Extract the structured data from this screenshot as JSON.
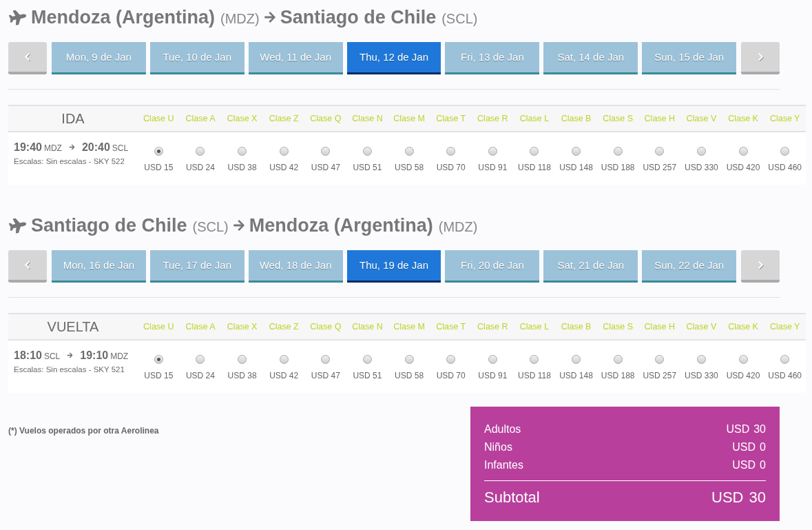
{
  "flights": [
    {
      "origin": {
        "city": "Mendoza (Argentina)",
        "code": "(MDZ)"
      },
      "destination": {
        "city": "Santiago de Chile",
        "code": "(SCL)"
      },
      "dates": [
        {
          "label": "Mon, 9 de Jan",
          "selected": false
        },
        {
          "label": "Tue, 10 de Jan",
          "selected": false
        },
        {
          "label": "Wed, 11 de Jan",
          "selected": false
        },
        {
          "label": "Thu, 12 de Jan",
          "selected": true
        },
        {
          "label": "Fri, 13 de Jan",
          "selected": false
        },
        {
          "label": "Sat, 14 de Jan",
          "selected": false
        },
        {
          "label": "Sun, 15 de Jan",
          "selected": false
        }
      ],
      "table": {
        "direction": "IDA",
        "classes": [
          "Clase U",
          "Clase A",
          "Clase X",
          "Clase Z",
          "Clase Q",
          "Clase N",
          "Clase M",
          "Clase T",
          "Clase R",
          "Clase L",
          "Clase B",
          "Clase S",
          "Clase H",
          "Clase V",
          "Clase K",
          "Clase Y"
        ],
        "flight": {
          "departure_time": "19:40",
          "departure_code": "MDZ",
          "arrival_time": "20:40",
          "arrival_code": "SCL",
          "details": "Escalas: Sin escalas - SKY 522"
        },
        "fares": [
          {
            "price": "USD 15",
            "selected": true
          },
          {
            "price": "USD 24",
            "selected": false
          },
          {
            "price": "USD 38",
            "selected": false
          },
          {
            "price": "USD 42",
            "selected": false
          },
          {
            "price": "USD 47",
            "selected": false
          },
          {
            "price": "USD 51",
            "selected": false
          },
          {
            "price": "USD 58",
            "selected": false
          },
          {
            "price": "USD 70",
            "selected": false
          },
          {
            "price": "USD 91",
            "selected": false
          },
          {
            "price": "USD 118",
            "selected": false
          },
          {
            "price": "USD 148",
            "selected": false
          },
          {
            "price": "USD 188",
            "selected": false
          },
          {
            "price": "USD 257",
            "selected": false
          },
          {
            "price": "USD 330",
            "selected": false
          },
          {
            "price": "USD 420",
            "selected": false
          },
          {
            "price": "USD 460",
            "selected": false
          }
        ]
      }
    },
    {
      "origin": {
        "city": "Santiago de Chile",
        "code": "(SCL)"
      },
      "destination": {
        "city": "Mendoza (Argentina)",
        "code": "(MDZ)"
      },
      "dates": [
        {
          "label": "Mon, 16 de Jan",
          "selected": false
        },
        {
          "label": "Tue, 17 de Jan",
          "selected": false
        },
        {
          "label": "Wed, 18 de Jan",
          "selected": false
        },
        {
          "label": "Thu, 19 de Jan",
          "selected": true
        },
        {
          "label": "Fri, 20 de Jan",
          "selected": false
        },
        {
          "label": "Sat, 21 de Jan",
          "selected": false
        },
        {
          "label": "Sun, 22 de Jan",
          "selected": false
        }
      ],
      "table": {
        "direction": "VUELTA",
        "classes": [
          "Clase U",
          "Clase A",
          "Clase X",
          "Clase Z",
          "Clase Q",
          "Clase N",
          "Clase M",
          "Clase T",
          "Clase R",
          "Clase L",
          "Clase B",
          "Clase S",
          "Clase H",
          "Clase V",
          "Clase K",
          "Clase Y"
        ],
        "flight": {
          "departure_time": "18:10",
          "departure_code": "SCL",
          "arrival_time": "19:10",
          "arrival_code": "MDZ",
          "details": "Escalas: Sin escalas - SKY 521"
        },
        "fares": [
          {
            "price": "USD 15",
            "selected": true
          },
          {
            "price": "USD 24",
            "selected": false
          },
          {
            "price": "USD 38",
            "selected": false
          },
          {
            "price": "USD 42",
            "selected": false
          },
          {
            "price": "USD 47",
            "selected": false
          },
          {
            "price": "USD 51",
            "selected": false
          },
          {
            "price": "USD 58",
            "selected": false
          },
          {
            "price": "USD 70",
            "selected": false
          },
          {
            "price": "USD 91",
            "selected": false
          },
          {
            "price": "USD 118",
            "selected": false
          },
          {
            "price": "USD 148",
            "selected": false
          },
          {
            "price": "USD 188",
            "selected": false
          },
          {
            "price": "USD 257",
            "selected": false
          },
          {
            "price": "USD 330",
            "selected": false
          },
          {
            "price": "USD 420",
            "selected": false
          },
          {
            "price": "USD 460",
            "selected": false
          }
        ]
      }
    }
  ],
  "footnote": "(*) Vuelos operados por otra Aerolinea",
  "summary": {
    "rows": [
      {
        "label": "Adultos",
        "currency": "USD",
        "amount": "30"
      },
      {
        "label": "Niños",
        "currency": "USD",
        "amount": "0"
      },
      {
        "label": "Infantes",
        "currency": "USD",
        "amount": "0"
      }
    ],
    "subtotal": {
      "label": "Subtotal",
      "currency": "USD",
      "amount": "30"
    }
  }
}
